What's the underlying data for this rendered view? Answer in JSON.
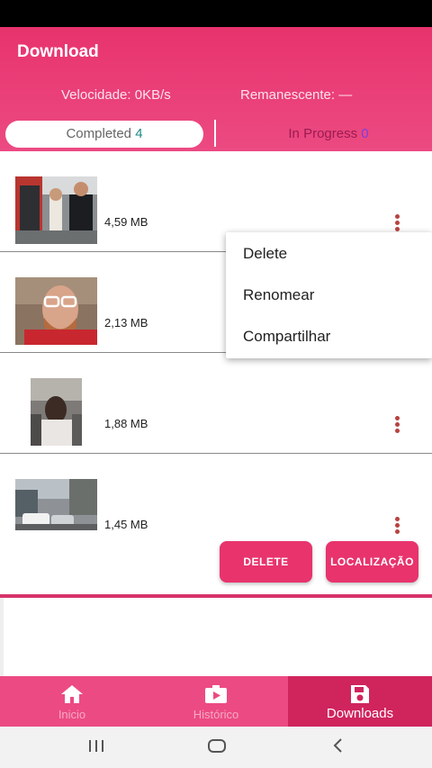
{
  "header": {
    "title": "Download",
    "speed": "Velocidade: 0KB/s",
    "remaining": "Remanescente: —"
  },
  "tabs": {
    "completed_label": "Completed",
    "completed_count": "4",
    "in_progress_label": "In Progress",
    "in_progress_count": "0"
  },
  "downloads": [
    {
      "size": "4,59 MB",
      "icon": "more-vert-icon"
    },
    {
      "size": "2,13 MB",
      "icon": "more-vert-icon"
    },
    {
      "size": "1,88 MB",
      "icon": "more-vert-icon"
    },
    {
      "size": "1,45 MB",
      "icon": "more-vert-icon"
    }
  ],
  "context_menu": {
    "items": [
      "Delete",
      "Renomear",
      "Compartilhar"
    ]
  },
  "actions": {
    "delete": "DELETE",
    "location": "LOCALIZAÇÃO"
  },
  "bottom_nav": {
    "items": [
      {
        "label": "Inicio",
        "icon": "home-icon"
      },
      {
        "label": "Histórico",
        "icon": "video-icon"
      },
      {
        "label": "Downloads",
        "icon": "save-icon"
      }
    ],
    "active_index": 2
  },
  "colors": {
    "accent": "#e8336d",
    "active_nav": "#d0245d"
  }
}
